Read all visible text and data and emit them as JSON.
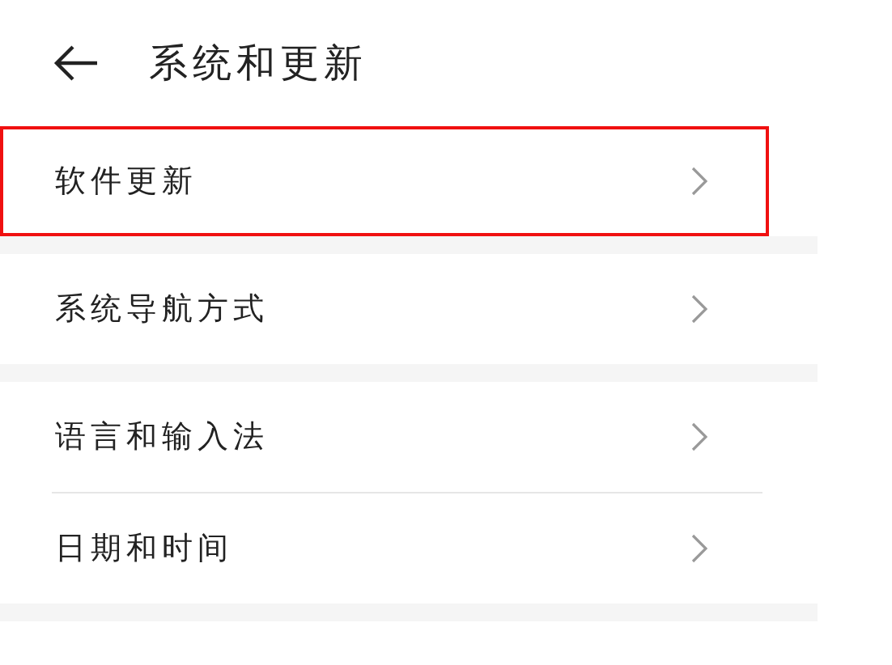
{
  "header": {
    "title": "系统和更新"
  },
  "groups": [
    {
      "items": [
        {
          "label": "软件更新",
          "highlighted": true
        }
      ]
    },
    {
      "items": [
        {
          "label": "系统导航方式",
          "highlighted": false
        }
      ]
    },
    {
      "items": [
        {
          "label": "语言和输入法",
          "highlighted": false
        },
        {
          "label": "日期和时间",
          "highlighted": false
        }
      ]
    }
  ]
}
